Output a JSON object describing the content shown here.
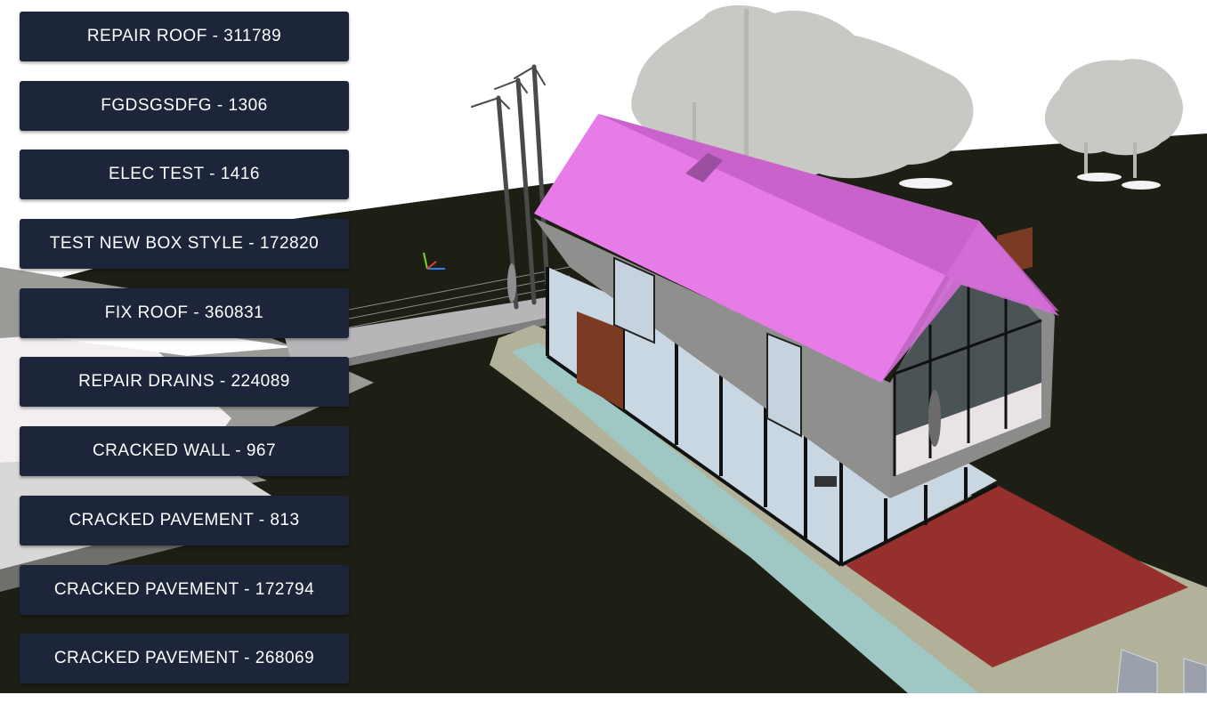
{
  "app": {
    "accent_color": "#1c2539",
    "highlight_color": "#e77ce9"
  },
  "tasks": [
    {
      "label": "REPAIR ROOF - 311789"
    },
    {
      "label": "FGDSGSDFG - 1306"
    },
    {
      "label": "ELEC TEST - 1416"
    },
    {
      "label": "TEST NEW BOX STYLE - 172820"
    },
    {
      "label": "FIX ROOF - 360831"
    },
    {
      "label": "REPAIR DRAINS - 224089"
    },
    {
      "label": "CRACKED WALL - 967"
    },
    {
      "label": "CRACKED PAVEMENT - 813"
    },
    {
      "label": "CRACKED PAVEMENT - 172794"
    },
    {
      "label": "CRACKED PAVEMENT - 268069"
    }
  ],
  "viewport": {
    "highlighted_element": "roof",
    "icons": [
      "axis-gizmo-icon"
    ]
  }
}
